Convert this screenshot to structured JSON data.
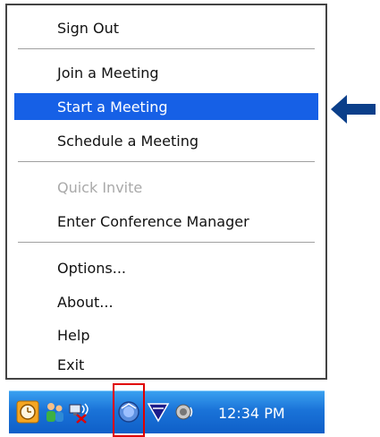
{
  "menu": {
    "items": [
      {
        "label": "Sign Out"
      },
      {
        "label": "Join a Meeting"
      },
      {
        "label": "Start a Meeting"
      },
      {
        "label": "Schedule a Meeting"
      },
      {
        "label": "Quick Invite"
      },
      {
        "label": "Enter Conference Manager"
      },
      {
        "label": "Options..."
      },
      {
        "label": "About..."
      },
      {
        "label": "Help"
      },
      {
        "label": "Exit"
      }
    ],
    "selected_item": "Start a Meeting",
    "disabled_item": "Quick Invite"
  },
  "taskbar": {
    "clock": "12:34 PM",
    "icons": [
      "clock-icon",
      "users-icon",
      "network-disconnected-icon",
      "meeting-app-icon",
      "vpn-shield-icon",
      "volume-icon"
    ]
  },
  "colors": {
    "selection": "#1660e6",
    "taskbar": "#1a73d8",
    "arrow": "#0b3f8a",
    "highlight_box": "#e00000"
  }
}
